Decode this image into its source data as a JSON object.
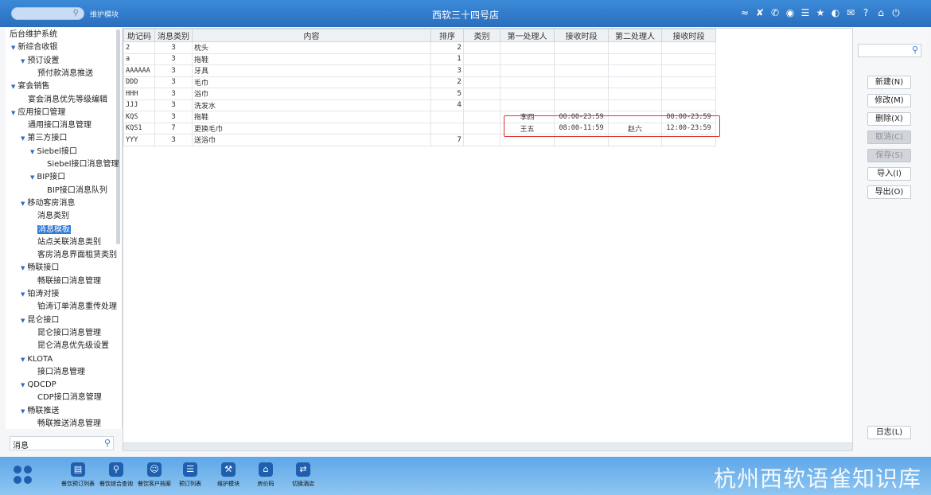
{
  "topbar": {
    "search_icon": "search-icon",
    "module_label": "维护模块",
    "title": "西软三十四号店",
    "icons": [
      "wifi-icon",
      "tools-icon",
      "phone-icon",
      "palette-icon",
      "menu-icon",
      "star-icon",
      "moon-icon",
      "mail-icon",
      "help-icon",
      "home-icon",
      "power-icon"
    ]
  },
  "sidebar": {
    "items": [
      {
        "label": "后台维护系统",
        "indent": 0,
        "arrow": false
      },
      {
        "label": "新综合收银",
        "indent": 1,
        "arrow": true
      },
      {
        "label": "预订设置",
        "indent": 2,
        "arrow": true
      },
      {
        "label": "预付款消息推送",
        "indent": 3,
        "arrow": false
      },
      {
        "label": "宴会销售",
        "indent": 1,
        "arrow": true
      },
      {
        "label": "宴会消息优先等级编辑",
        "indent": 2,
        "arrow": false
      },
      {
        "label": "应用接口管理",
        "indent": 1,
        "arrow": true
      },
      {
        "label": "通用接口消息管理",
        "indent": 2,
        "arrow": false
      },
      {
        "label": "第三方接口",
        "indent": 2,
        "arrow": true
      },
      {
        "label": "Siebel接口",
        "indent": 3,
        "arrow": true
      },
      {
        "label": "Siebel接口消息管理",
        "indent": 4,
        "arrow": false
      },
      {
        "label": "BIP接口",
        "indent": 3,
        "arrow": true
      },
      {
        "label": "BIP接口消息队列",
        "indent": 4,
        "arrow": false
      },
      {
        "label": "移动客房消息",
        "indent": 2,
        "arrow": true
      },
      {
        "label": "消息类别",
        "indent": 3,
        "arrow": false
      },
      {
        "label": "消息模板",
        "indent": 3,
        "arrow": false,
        "selected": true
      },
      {
        "label": "站点关联消息类别",
        "indent": 3,
        "arrow": false
      },
      {
        "label": "客房消息界面租赁类别",
        "indent": 3,
        "arrow": false
      },
      {
        "label": "畅联接口",
        "indent": 2,
        "arrow": true
      },
      {
        "label": "畅联接口消息管理",
        "indent": 3,
        "arrow": false
      },
      {
        "label": "铂涛对接",
        "indent": 2,
        "arrow": true
      },
      {
        "label": "铂涛订单消息重传处理",
        "indent": 3,
        "arrow": false
      },
      {
        "label": "昆仑接口",
        "indent": 2,
        "arrow": true
      },
      {
        "label": "昆仑接口消息管理",
        "indent": 3,
        "arrow": false
      },
      {
        "label": "昆仑消息优先级设置",
        "indent": 3,
        "arrow": false
      },
      {
        "label": "KLOTA",
        "indent": 2,
        "arrow": true
      },
      {
        "label": "接口消息管理",
        "indent": 3,
        "arrow": false
      },
      {
        "label": "QDCDP",
        "indent": 2,
        "arrow": true
      },
      {
        "label": "CDP接口消息管理",
        "indent": 3,
        "arrow": false
      },
      {
        "label": "畅联推送",
        "indent": 2,
        "arrow": true
      },
      {
        "label": "畅联推送消息管理",
        "indent": 3,
        "arrow": false
      }
    ],
    "search_value": "消息"
  },
  "grid": {
    "columns": [
      "助记码",
      "消息类别",
      "内容",
      "排序",
      "类别",
      "第一处理人",
      "接收时段",
      "第二处理人",
      "接收时段"
    ],
    "rows": [
      [
        "2",
        "3",
        "枕头",
        "2",
        "",
        "",
        "",
        "",
        ""
      ],
      [
        "a",
        "3",
        "拖鞋",
        "1",
        "",
        "",
        "",
        "",
        ""
      ],
      [
        "AAAAAA",
        "3",
        "牙具",
        "3",
        "",
        "",
        "",
        "",
        ""
      ],
      [
        "DDD",
        "3",
        "毛巾",
        "2",
        "",
        "",
        "",
        "",
        ""
      ],
      [
        "HHH",
        "3",
        "浴巾",
        "5",
        "",
        "",
        "",
        "",
        ""
      ],
      [
        "JJJ",
        "3",
        "洗发水",
        "4",
        "",
        "",
        "",
        "",
        ""
      ],
      [
        "KQS",
        "3",
        "拖鞋",
        "",
        "",
        "李四",
        "00:00-23:59",
        "",
        "00:00-23:59"
      ],
      [
        "KQS1",
        "7",
        "更换毛巾",
        "",
        "",
        "王五",
        "08:00-11:59",
        "赵六",
        "12:00-23:59"
      ],
      [
        "YYY",
        "3",
        "送浴巾",
        "7",
        "",
        "",
        "",
        "",
        ""
      ]
    ]
  },
  "right_panel": {
    "search_icon": "search-icon",
    "buttons": {
      "new": "新建(N)",
      "edit": "修改(M)",
      "delete": "删除(X)",
      "cancel": "取消(C)",
      "save": "保存(S)",
      "import": "导入(I)",
      "export": "导出(O)",
      "log": "日志(L)"
    }
  },
  "taskbar": {
    "items": [
      {
        "label": "餐饮预订列表",
        "icon": "clipboard-icon"
      },
      {
        "label": "餐饮综合查询",
        "icon": "search-icon"
      },
      {
        "label": "餐饮客户档案",
        "icon": "user-icon"
      },
      {
        "label": "预订列表",
        "icon": "list-icon"
      },
      {
        "label": "维护模块",
        "icon": "wrench-icon"
      },
      {
        "label": "房价码",
        "icon": "house-icon"
      },
      {
        "label": "切换酒店",
        "icon": "switch-icon"
      }
    ],
    "watermark": "杭州西软语雀知识库"
  }
}
